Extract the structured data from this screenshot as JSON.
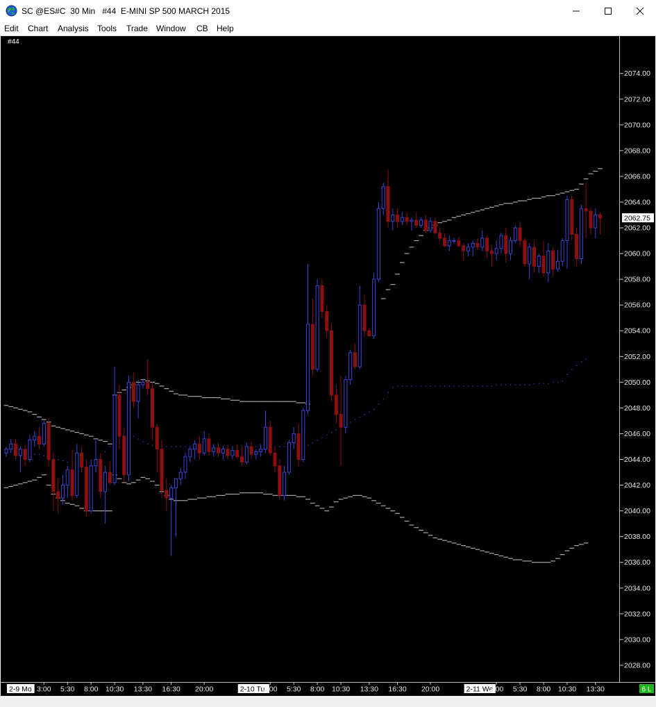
{
  "window": {
    "title": "SC @ES#C  30 Min   #44  E-MINI SP 500 MARCH 2015"
  },
  "menu": {
    "items": [
      "Edit",
      "Chart",
      "Analysis",
      "Tools",
      "Trade",
      "Window",
      "CB",
      "Help"
    ]
  },
  "chart": {
    "label": "#44",
    "last_price_label": "2062.75",
    "status_badge": "6 L"
  },
  "colors": {
    "up_candle": "#3a46d8",
    "down_candle": "#8b1010",
    "band": "#a8a8a8",
    "vwap": "#3548ff",
    "badge": "#1fb61f"
  },
  "chart_data": {
    "type": "candlestick",
    "title": "E-MINI SP 500 MARCH 2015",
    "interval": "30 Min",
    "y_ticks": [
      "2074.00",
      "2072.00",
      "2070.00",
      "2068.00",
      "2066.00",
      "2064.00",
      "2062.00",
      "2060.00",
      "2058.00",
      "2056.00",
      "2054.00",
      "2052.00",
      "2050.00",
      "2048.00",
      "2046.00",
      "2044.00",
      "2042.00",
      "2040.00",
      "2038.00",
      "2036.00",
      "2034.00",
      "2032.00",
      "2030.00",
      "2028.00"
    ],
    "ylim": [
      2026.7,
      2076.9
    ],
    "x_ticks": [
      {
        "label": "2-9 Mo",
        "index": 0,
        "session": true
      },
      {
        "label": "3:00",
        "index": 8
      },
      {
        "label": "5:30",
        "index": 13
      },
      {
        "label": "8:00",
        "index": 18
      },
      {
        "label": "10:30",
        "index": 23
      },
      {
        "label": "13:30",
        "index": 29
      },
      {
        "label": "16:30",
        "index": 35
      },
      {
        "label": "20:00",
        "index": 42
      },
      {
        "label": "2-10 Tu",
        "index": 49,
        "session": true
      },
      {
        "label": "3:00",
        "index": 56
      },
      {
        "label": "5:30",
        "index": 61
      },
      {
        "label": "8:00",
        "index": 66
      },
      {
        "label": "10:30",
        "index": 71
      },
      {
        "label": "13:30",
        "index": 77
      },
      {
        "label": "16:30",
        "index": 83
      },
      {
        "label": "20:00",
        "index": 90
      },
      {
        "label": "2-11 We",
        "index": 97,
        "session": true
      },
      {
        "label": "3:00",
        "index": 104
      },
      {
        "label": "5:30",
        "index": 109
      },
      {
        "label": "8:00",
        "index": 114
      },
      {
        "label": "10:30",
        "index": 119
      },
      {
        "label": "13:30",
        "index": 125
      }
    ],
    "ohlc": [
      [
        2044.5,
        2045.0,
        2044.2,
        2044.8
      ],
      [
        2044.8,
        2045.6,
        2044.5,
        2045.2
      ],
      [
        2045.2,
        2045.6,
        2044.0,
        2044.3
      ],
      [
        2044.3,
        2045.0,
        2043.0,
        2044.8
      ],
      [
        2044.8,
        2045.2,
        2043.5,
        2044.0
      ],
      [
        2044.0,
        2045.9,
        2043.8,
        2045.5
      ],
      [
        2045.5,
        2046.2,
        2045.0,
        2045.8
      ],
      [
        2045.8,
        2046.5,
        2044.8,
        2045.2
      ],
      [
        2045.2,
        2047.0,
        2045.0,
        2046.8
      ],
      [
        2046.8,
        2047.2,
        2043.5,
        2044.0
      ],
      [
        2044.0,
        2044.5,
        2040.0,
        2041.5
      ],
      [
        2041.5,
        2042.5,
        2039.8,
        2041.0
      ],
      [
        2041.0,
        2042.8,
        2040.5,
        2042.0
      ],
      [
        2042.0,
        2043.5,
        2041.0,
        2043.2
      ],
      [
        2043.2,
        2044.8,
        2040.8,
        2041.2
      ],
      [
        2041.2,
        2045.2,
        2041.0,
        2044.5
      ],
      [
        2044.5,
        2045.0,
        2043.0,
        2043.4
      ],
      [
        2043.4,
        2044.0,
        2039.6,
        2040.0
      ],
      [
        2040.0,
        2044.0,
        2039.8,
        2043.5
      ],
      [
        2043.5,
        2045.5,
        2043.0,
        2044.0
      ],
      [
        2044.0,
        2044.5,
        2041.0,
        2041.5
      ],
      [
        2041.5,
        2043.5,
        2039.0,
        2043.0
      ],
      [
        2043.0,
        2043.8,
        2042.0,
        2042.2
      ],
      [
        2042.2,
        2051.2,
        2042.0,
        2049.0
      ],
      [
        2049.0,
        2049.8,
        2044.8,
        2045.8
      ],
      [
        2045.8,
        2046.5,
        2042.2,
        2042.8
      ],
      [
        2042.8,
        2050.5,
        2042.3,
        2050.0
      ],
      [
        2050.0,
        2050.8,
        2048.0,
        2048.5
      ],
      [
        2048.5,
        2050.2,
        2047.2,
        2049.8
      ],
      [
        2049.8,
        2050.3,
        2049.5,
        2050.0
      ],
      [
        2050.0,
        2051.8,
        2049.0,
        2049.5
      ],
      [
        2049.5,
        2050.0,
        2045.5,
        2046.5
      ],
      [
        2046.5,
        2046.8,
        2043.0,
        2044.8
      ],
      [
        2044.8,
        2045.5,
        2041.0,
        2041.6
      ],
      [
        2041.6,
        2042.5,
        2040.0,
        2041.0
      ],
      [
        2041.0,
        2042.0,
        2036.5,
        2041.8
      ],
      [
        2041.8,
        2042.5,
        2038.0,
        2042.5
      ],
      [
        2042.5,
        2043.3,
        2042.0,
        2043.0
      ],
      [
        2043.0,
        2044.5,
        2042.5,
        2044.2
      ],
      [
        2044.2,
        2045.0,
        2043.8,
        2044.8
      ],
      [
        2044.8,
        2045.5,
        2044.0,
        2045.2
      ],
      [
        2045.2,
        2045.8,
        2044.0,
        2044.5
      ],
      [
        2044.5,
        2046.2,
        2044.3,
        2045.6
      ],
      [
        2045.6,
        2046.0,
        2044.3,
        2044.6
      ],
      [
        2044.6,
        2045.2,
        2044.2,
        2044.9
      ],
      [
        2044.9,
        2045.3,
        2044.2,
        2044.5
      ],
      [
        2044.5,
        2045.0,
        2044.0,
        2044.8
      ],
      [
        2044.8,
        2045.2,
        2044.0,
        2044.3
      ],
      [
        2044.3,
        2045.0,
        2044.0,
        2044.7
      ],
      [
        2044.7,
        2045.2,
        2044.0,
        2044.2
      ],
      [
        2044.2,
        2045.0,
        2043.5,
        2043.8
      ],
      [
        2043.8,
        2045.3,
        2043.6,
        2045.0
      ],
      [
        2045.0,
        2045.4,
        2044.0,
        2044.4
      ],
      [
        2044.4,
        2044.8,
        2044.0,
        2044.6
      ],
      [
        2044.6,
        2045.2,
        2044.2,
        2044.8
      ],
      [
        2044.8,
        2047.8,
        2044.5,
        2046.5
      ],
      [
        2046.5,
        2047.0,
        2044.3,
        2044.5
      ],
      [
        2044.5,
        2045.0,
        2043.0,
        2043.5
      ],
      [
        2043.5,
        2044.0,
        2040.8,
        2041.2
      ],
      [
        2041.2,
        2043.5,
        2040.8,
        2043.0
      ],
      [
        2043.0,
        2045.5,
        2042.8,
        2045.3
      ],
      [
        2045.3,
        2046.5,
        2044.8,
        2046.0
      ],
      [
        2046.0,
        2046.8,
        2043.5,
        2044.0
      ],
      [
        2044.0,
        2048.0,
        2043.8,
        2047.8
      ],
      [
        2047.8,
        2059.2,
        2047.5,
        2054.5
      ],
      [
        2054.5,
        2056.5,
        2050.5,
        2051.0
      ],
      [
        2051.0,
        2058.0,
        2050.8,
        2057.5
      ],
      [
        2057.5,
        2058.0,
        2055.0,
        2055.5
      ],
      [
        2055.5,
        2056.0,
        2053.5,
        2054.0
      ],
      [
        2054.0,
        2054.5,
        2048.5,
        2049.0
      ],
      [
        2049.0,
        2049.8,
        2046.8,
        2047.5
      ],
      [
        2047.5,
        2050.5,
        2043.5,
        2046.5
      ],
      [
        2046.5,
        2050.5,
        2046.0,
        2050.2
      ],
      [
        2050.2,
        2052.5,
        2049.8,
        2052.3
      ],
      [
        2052.3,
        2053.0,
        2051.0,
        2051.2
      ],
      [
        2051.2,
        2057.5,
        2051.0,
        2056.0
      ],
      [
        2056.0,
        2056.8,
        2053.5,
        2054.0
      ],
      [
        2054.0,
        2054.2,
        2053.5,
        2053.6
      ],
      [
        2053.6,
        2058.5,
        2053.4,
        2058.0
      ],
      [
        2058.0,
        2064.0,
        2057.8,
        2063.5
      ],
      [
        2063.5,
        2065.5,
        2063.0,
        2065.2
      ],
      [
        2065.2,
        2066.5,
        2062.0,
        2062.5
      ],
      [
        2062.5,
        2063.5,
        2061.8,
        2063.0
      ],
      [
        2063.0,
        2063.5,
        2062.0,
        2062.5
      ],
      [
        2062.5,
        2063.2,
        2062.2,
        2062.8
      ],
      [
        2062.8,
        2063.2,
        2062.2,
        2062.5
      ],
      [
        2062.5,
        2062.8,
        2061.8,
        2062.6
      ],
      [
        2062.6,
        2063.2,
        2062.0,
        2062.2
      ],
      [
        2062.2,
        2062.8,
        2062.0,
        2062.6
      ],
      [
        2062.6,
        2063.0,
        2061.6,
        2061.8
      ],
      [
        2061.8,
        2062.8,
        2061.6,
        2062.5
      ],
      [
        2062.5,
        2062.8,
        2061.5,
        2061.6
      ],
      [
        2061.6,
        2062.0,
        2061.0,
        2061.2
      ],
      [
        2061.2,
        2061.6,
        2060.5,
        2060.6
      ],
      [
        2060.6,
        2061.4,
        2060.2,
        2061.0
      ],
      [
        2061.0,
        2061.2,
        2060.8,
        2061.0
      ],
      [
        2061.0,
        2061.3,
        2060.5,
        2060.6
      ],
      [
        2060.6,
        2060.8,
        2059.5,
        2060.2
      ],
      [
        2060.2,
        2060.8,
        2059.8,
        2060.5
      ],
      [
        2060.5,
        2061.0,
        2059.8,
        2060.8
      ],
      [
        2060.8,
        2061.2,
        2060.3,
        2060.5
      ],
      [
        2060.5,
        2061.8,
        2060.2,
        2061.2
      ],
      [
        2061.2,
        2061.4,
        2059.6,
        2060.2
      ],
      [
        2060.2,
        2060.6,
        2059.0,
        2060.0
      ],
      [
        2060.0,
        2061.0,
        2059.5,
        2060.4
      ],
      [
        2060.4,
        2061.6,
        2060.0,
        2061.4
      ],
      [
        2061.4,
        2062.0,
        2059.3,
        2060.0
      ],
      [
        2060.0,
        2061.3,
        2059.5,
        2061.0
      ],
      [
        2061.0,
        2062.2,
        2060.8,
        2062.0
      ],
      [
        2062.0,
        2062.5,
        2060.5,
        2061.0
      ],
      [
        2061.0,
        2061.2,
        2059.0,
        2059.2
      ],
      [
        2059.2,
        2060.8,
        2058.0,
        2060.5
      ],
      [
        2060.5,
        2061.0,
        2058.5,
        2059.0
      ],
      [
        2059.0,
        2060.0,
        2058.5,
        2059.8
      ],
      [
        2059.8,
        2061.0,
        2058.2,
        2058.5
      ],
      [
        2058.5,
        2060.8,
        2057.8,
        2060.2
      ],
      [
        2060.2,
        2060.5,
        2058.3,
        2058.8
      ],
      [
        2058.8,
        2060.3,
        2058.6,
        2059.4
      ],
      [
        2059.4,
        2061.2,
        2059.0,
        2061.0
      ],
      [
        2061.0,
        2064.5,
        2058.8,
        2064.2
      ],
      [
        2064.2,
        2064.5,
        2061.0,
        2061.5
      ],
      [
        2061.5,
        2062.0,
        2059.0,
        2059.6
      ],
      [
        2059.6,
        2063.8,
        2059.2,
        2063.5
      ],
      [
        2063.5,
        2065.5,
        2061.2,
        2063.3
      ],
      [
        2063.3,
        2063.6,
        2061.5,
        2062.0
      ],
      [
        2062.0,
        2063.5,
        2061.2,
        2063.0
      ],
      [
        2063.0,
        2063.2,
        2061.5,
        2062.75
      ]
    ],
    "upper_band": [
      2048.2,
      2048.1,
      2048.0,
      2047.9,
      2047.8,
      2047.7,
      2047.5,
      2047.3,
      2047.1,
      2046.9,
      2046.6,
      2046.5,
      2046.4,
      2046.3,
      2046.2,
      2046.1,
      2046.0,
      2045.9,
      2045.8,
      2045.6,
      2045.5,
      2045.4,
      2045.2,
      2049.0,
      2049.2,
      2049.4,
      2049.6,
      2049.8,
      2050.0,
      2050.2,
      2050.1,
      2050.0,
      2049.9,
      2049.7,
      2049.5,
      2049.3,
      2049.1,
      2049.0,
      2049.0,
      2048.9,
      2048.9,
      2048.9,
      2048.8,
      2048.8,
      2048.8,
      2048.8,
      2048.7,
      2048.7,
      2048.6,
      2048.6,
      2048.5,
      2048.5,
      2048.5,
      2048.5,
      2048.5,
      2048.5,
      2048.5,
      2048.5,
      2048.5,
      2048.5,
      2048.5,
      2048.5,
      2048.4,
      2048.4,
      2048.3,
      null,
      null,
      null,
      null,
      null,
      null,
      null,
      null,
      null,
      null,
      null,
      null,
      null,
      null,
      null,
      2056.5,
      2057.2,
      2057.6,
      2058.4,
      2059.3,
      2060.0,
      2060.5,
      2061.0,
      2061.4,
      2061.8,
      2062.0,
      2062.2,
      2062.4,
      2062.5,
      2062.6,
      2062.8,
      2062.9,
      2063.0,
      2063.1,
      2063.2,
      2063.3,
      2063.4,
      2063.5,
      2063.6,
      2063.7,
      2063.8,
      2063.9,
      2063.9,
      2064.0,
      2064.1,
      2064.1,
      2064.2,
      2064.3,
      2064.3,
      2064.4,
      2064.5,
      2064.5,
      2064.6,
      2064.7,
      2064.8,
      2064.9,
      2065.0,
      2065.4,
      2065.8,
      2066.2,
      2066.4,
      2066.6
    ],
    "lower_band": [
      2041.8,
      2041.9,
      2042.0,
      2042.1,
      2042.2,
      2042.3,
      2042.4,
      2042.6,
      2042.8,
      2042.0,
      2041.3,
      2041.0,
      2040.8,
      2040.6,
      2040.5,
      2040.4,
      2040.2,
      2040.0,
      2040.0,
      2040.0,
      2040.0,
      2040.0,
      2040.0,
      2042.8,
      2042.5,
      2042.2,
      2042.1,
      2042.2,
      2042.4,
      2042.6,
      2042.5,
      2042.3,
      2042.0,
      2041.5,
      2041.2,
      2040.9,
      2040.8,
      2040.8,
      2040.8,
      2040.9,
      2040.9,
      2041.0,
      2041.0,
      2041.1,
      2041.1,
      2041.2,
      2041.2,
      2041.3,
      2041.3,
      2041.3,
      2041.4,
      2041.4,
      2041.4,
      2041.4,
      2041.4,
      2041.3,
      2041.3,
      2041.2,
      2041.2,
      2041.2,
      2041.2,
      2041.2,
      2041.1,
      2041.1,
      2040.9,
      2040.6,
      2040.4,
      2040.2,
      2040.0,
      2040.3,
      2040.7,
      2040.9,
      2041.0,
      2041.1,
      2041.2,
      2041.2,
      2041.1,
      2041.0,
      2040.8,
      2040.6,
      2040.4,
      2040.2,
      2040.0,
      2039.8,
      2039.5,
      2039.2,
      2038.9,
      2038.7,
      2038.5,
      2038.3,
      2038.1,
      2037.9,
      2037.8,
      2037.7,
      2037.6,
      2037.5,
      2037.4,
      2037.3,
      2037.2,
      2037.1,
      2037.0,
      2036.9,
      2036.8,
      2036.7,
      2036.6,
      2036.5,
      2036.4,
      2036.3,
      2036.2,
      2036.2,
      2036.1,
      2036.1,
      2036.0,
      2036.0,
      2036.0,
      2036.0,
      2036.1,
      2036.3,
      2036.6,
      2036.9,
      2037.1,
      2037.3,
      2037.4,
      2037.5
    ],
    "vwap": [
      2044.8,
      2044.8,
      2044.7,
      2044.6,
      2044.5,
      2044.5,
      2044.4,
      2044.4,
      2044.3,
      2044.2,
      2044.1,
      2044.0,
      2043.9,
      2043.8,
      2043.8,
      2043.7,
      2043.6,
      2043.5,
      2043.5,
      2043.8,
      2044.2,
      2044.6,
      2045.0,
      2045.3,
      2045.5,
      2045.7,
      2045.8,
      2045.8,
      2045.6,
      2045.4,
      2045.2,
      2045.1,
      2045.1,
      2045.0,
      2045.0,
      2045.0,
      2045.0,
      2045.0,
      2045.0,
      2045.0,
      2045.0,
      2045.0,
      2045.0,
      2045.0,
      2045.0,
      2045.0,
      2045.0,
      2045.0,
      2045.0,
      2045.0,
      2045.0,
      2045.0,
      2045.0,
      2045.0,
      2045.0,
      2045.0,
      2045.0,
      2045.0,
      2045.0,
      2045.0,
      2045.0,
      2045.0,
      2045.0,
      2045.0,
      2045.1,
      2045.3,
      2045.5,
      2045.7,
      2045.9,
      2046.1,
      2046.3,
      2046.5,
      2046.7,
      2046.9,
      2047.1,
      2047.3,
      2047.5,
      2047.7,
      2047.9,
      2048.3,
      2048.7,
      2049.2,
      2049.6,
      2049.7,
      2049.7,
      2049.7,
      2049.7,
      2049.7,
      2049.7,
      2049.7,
      2049.7,
      2049.7,
      2049.7,
      2049.7,
      2049.7,
      2049.7,
      2049.7,
      2049.7,
      2049.7,
      2049.7,
      2049.7,
      2049.7,
      2049.7,
      2049.7,
      2049.8,
      2049.8,
      2049.8,
      2049.8,
      2049.8,
      2049.8,
      2049.8,
      2049.8,
      2049.9,
      2049.9,
      2049.9,
      2049.9,
      2050.0,
      2050.0,
      2050.1,
      2050.6,
      2051.0,
      2051.3,
      2051.6,
      2051.8
    ]
  }
}
